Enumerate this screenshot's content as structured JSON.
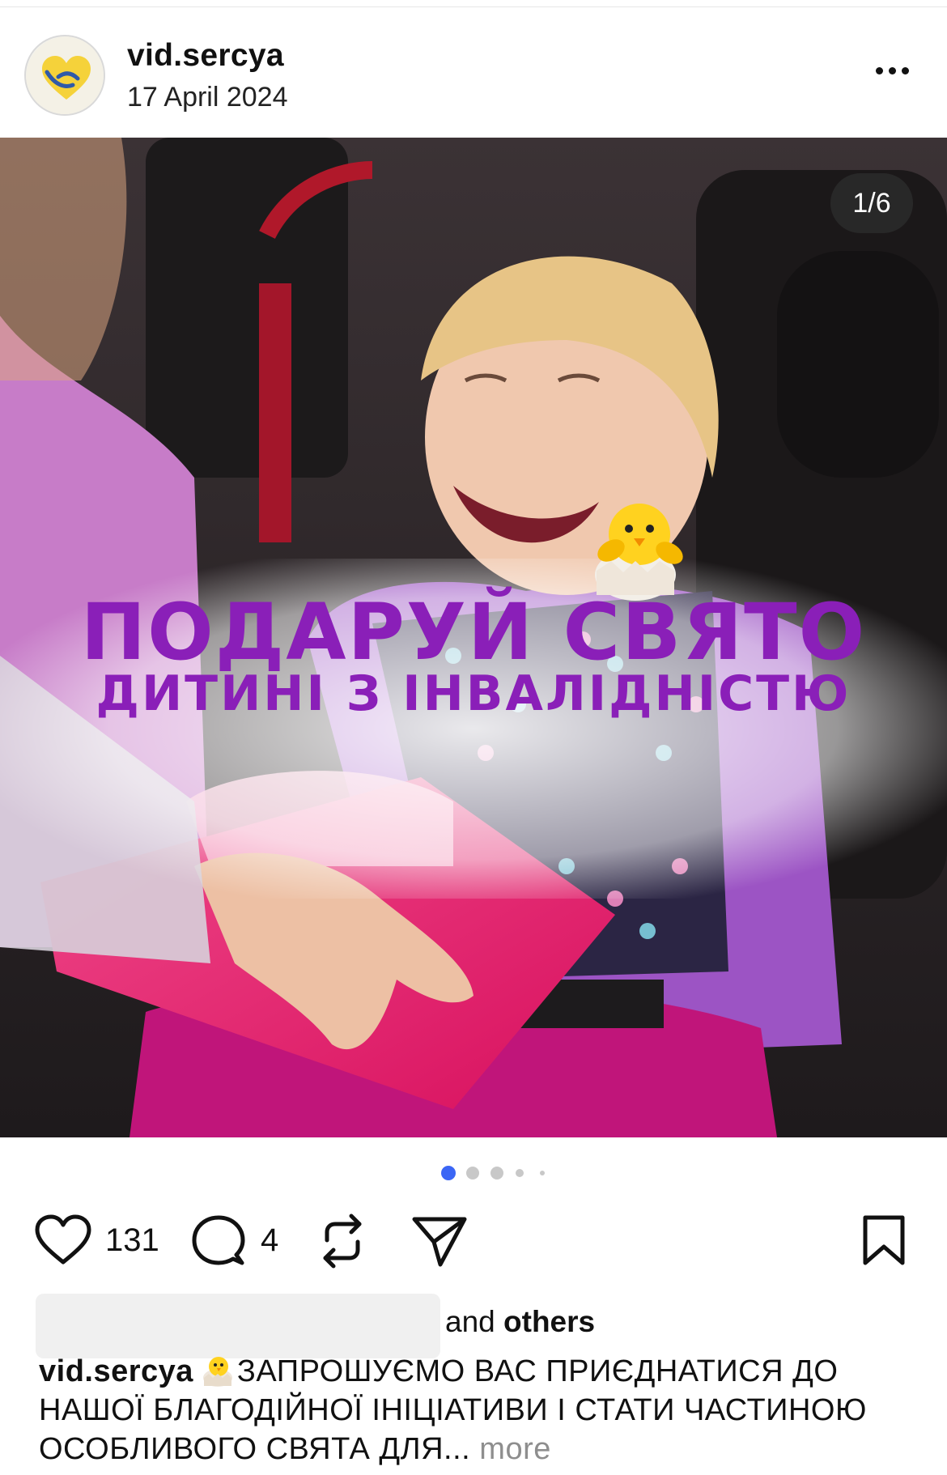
{
  "post": {
    "username": "vid.sercya",
    "date": "17 April 2024"
  },
  "media": {
    "counter": "1/6",
    "headline_line1": "ПОДАРУЙ СВЯТО",
    "headline_line2": "ДИТИНІ З ІНВАЛІДНІСТЮ",
    "slide_index": 1,
    "slide_count": 6
  },
  "actions": {
    "likes_count": "131",
    "comments_count": "4"
  },
  "likes": {
    "and_text": "and",
    "others_text": "others"
  },
  "caption": {
    "username": "vid.sercya",
    "text": "ЗАПРОШУЄМО ВАС ПРИЄДНАТИСЯ ДО НАШОЇ БЛАГОДІЙНОЇ ІНІЦІАТИВИ І СТАТИ ЧАСТИНОЮ ОСОБЛИВОГО СВЯТА ДЛЯ...",
    "more_label": "more"
  },
  "colors": {
    "headline": "#8a1fb8",
    "active_dot": "#3b66f5",
    "inactive_dot": "#c8c8c8"
  },
  "icons": [
    "heart-icon",
    "comment-icon",
    "repost-icon",
    "share-icon",
    "bookmark-icon",
    "more-icon",
    "chick-emoji"
  ]
}
